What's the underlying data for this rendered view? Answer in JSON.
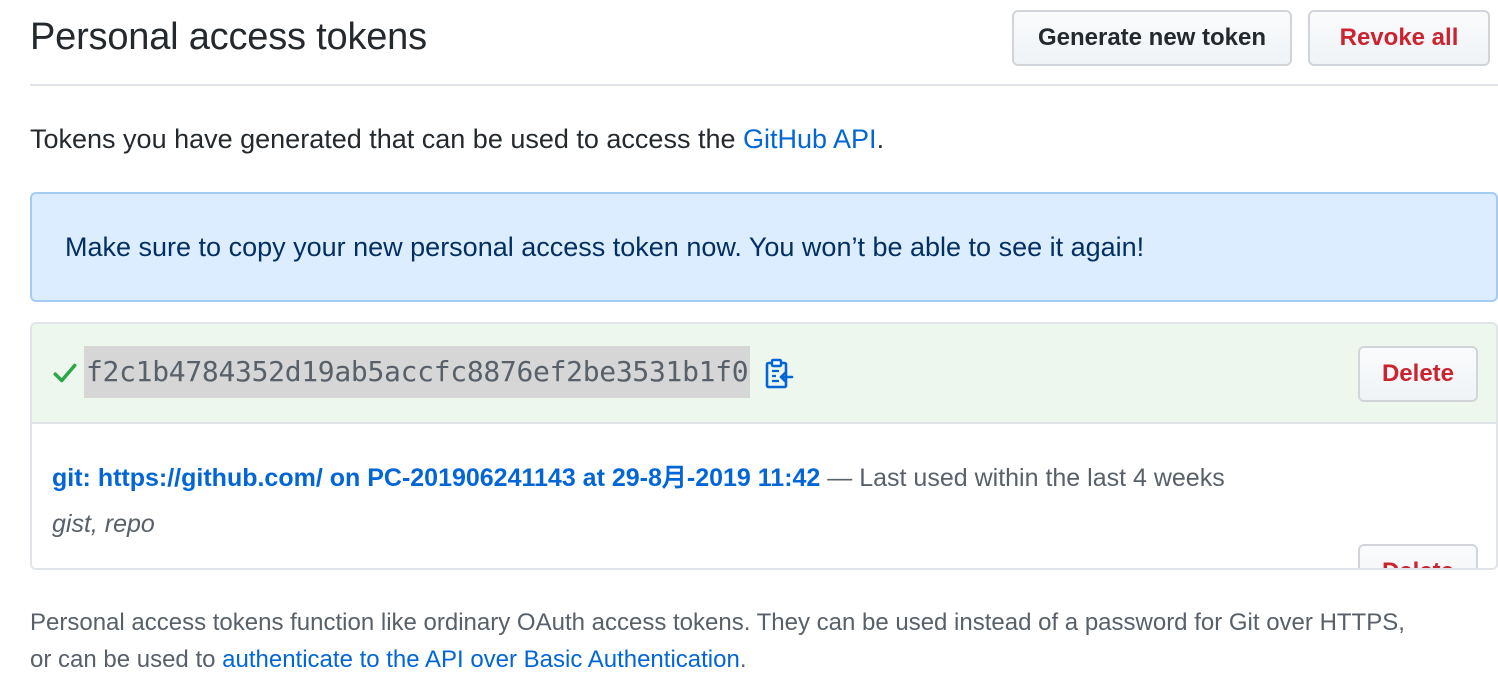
{
  "header": {
    "title": "Personal access tokens",
    "generate_label": "Generate new token",
    "revoke_label": "Revoke all"
  },
  "intro": {
    "prefix": "Tokens you have generated that can be used to access the ",
    "link": "GitHub API",
    "suffix": "."
  },
  "flash": {
    "message": "Make sure to copy your new personal access token now. You won’t be able to see it again!"
  },
  "new_token": {
    "value": "f2c1b4784352d19ab5accfc8876ef2be3531b1f0",
    "delete_label": "Delete",
    "icons": [
      "check-icon",
      "clipboard-icon"
    ]
  },
  "existing_token": {
    "description": "git: https://github.com/ on PC-201906241143 at 29-8月-2019 11:42",
    "meta": " — Last used within the last 4 weeks",
    "scopes": "gist, repo",
    "delete_label": "Delete"
  },
  "footer": {
    "line1": "Personal access tokens function like ordinary OAuth access tokens. They can be used instead of a password for Git over HTTPS,",
    "line2_prefix": "or can be used to ",
    "line2_link": "authenticate to the API over Basic Authentication",
    "line2_suffix": "."
  },
  "colors": {
    "link": "#0366d6",
    "danger": "#cb2431",
    "success": "#28a745",
    "flash_bg": "#dbedff",
    "new_token_bg": "#eef7ee"
  }
}
